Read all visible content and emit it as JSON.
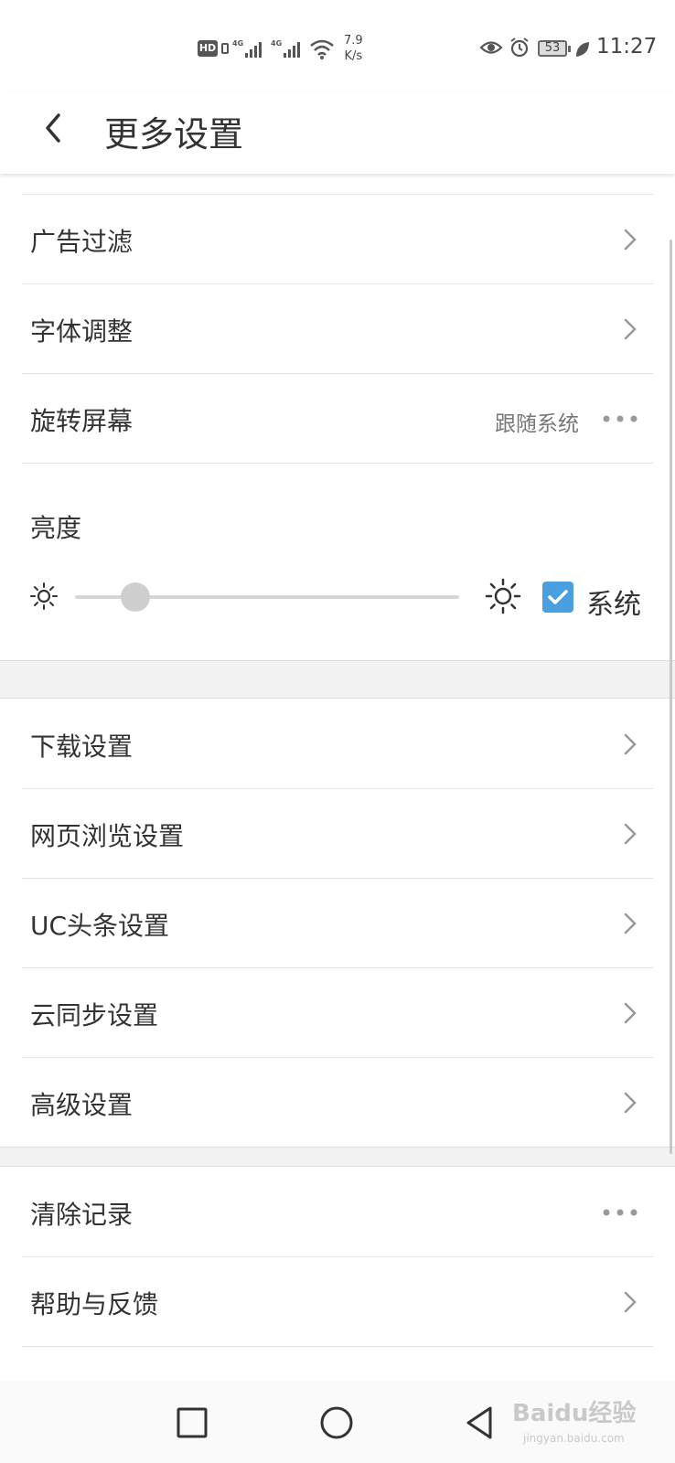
{
  "status_bar": {
    "hd_label": "HD",
    "net_speed_value": "7.9",
    "net_speed_unit": "K/s",
    "battery": "53",
    "time": "11:27"
  },
  "header": {
    "title": "更多设置"
  },
  "section1": [
    {
      "label": "广告过滤"
    },
    {
      "label": "字体调整"
    },
    {
      "label": "旋转屏幕",
      "value": "跟随系统"
    }
  ],
  "brightness": {
    "label": "亮度",
    "level_fraction": 0.12,
    "system_checked": true,
    "system_label": "系统"
  },
  "section2": [
    {
      "label": "下载设置"
    },
    {
      "label": "网页浏览设置"
    },
    {
      "label": "UC头条设置"
    },
    {
      "label": "云同步设置"
    },
    {
      "label": "高级设置"
    }
  ],
  "section3": [
    {
      "label": "清除记录"
    },
    {
      "label": "帮助与反馈"
    }
  ],
  "watermark": {
    "text": "Baidu经验",
    "sub": "jingyan.baidu.com"
  },
  "colors": {
    "accent": "#4a9fe0",
    "text": "#333333",
    "secondary_text": "#777777",
    "divider": "#e3e3e3",
    "section_gap": "#f2f2f2"
  }
}
